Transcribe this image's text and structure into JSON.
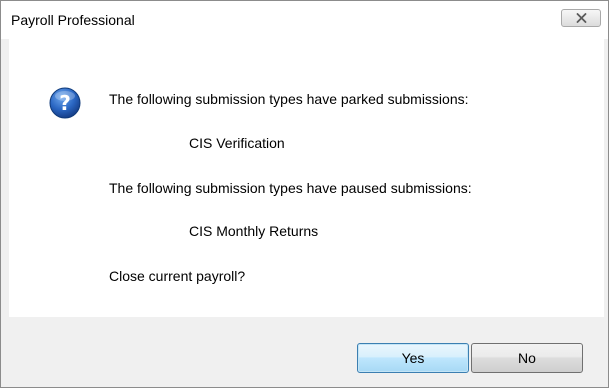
{
  "window": {
    "title": "Payroll Professional",
    "close_icon": "close-icon"
  },
  "message": {
    "icon": "question-icon",
    "icon_glyph": "?",
    "parked_heading": "The following submission types have parked submissions:",
    "parked_item": "CIS Verification",
    "paused_heading": "The following submission types have paused submissions:",
    "paused_item": "CIS Monthly Returns",
    "question": "Close current payroll?"
  },
  "buttons": {
    "yes_label": "Yes",
    "no_label": "No"
  },
  "colors": {
    "icon_blue": "#1f5fb3",
    "default_button_border": "#3c7fb1",
    "footer_background": "#f0f0f0"
  }
}
